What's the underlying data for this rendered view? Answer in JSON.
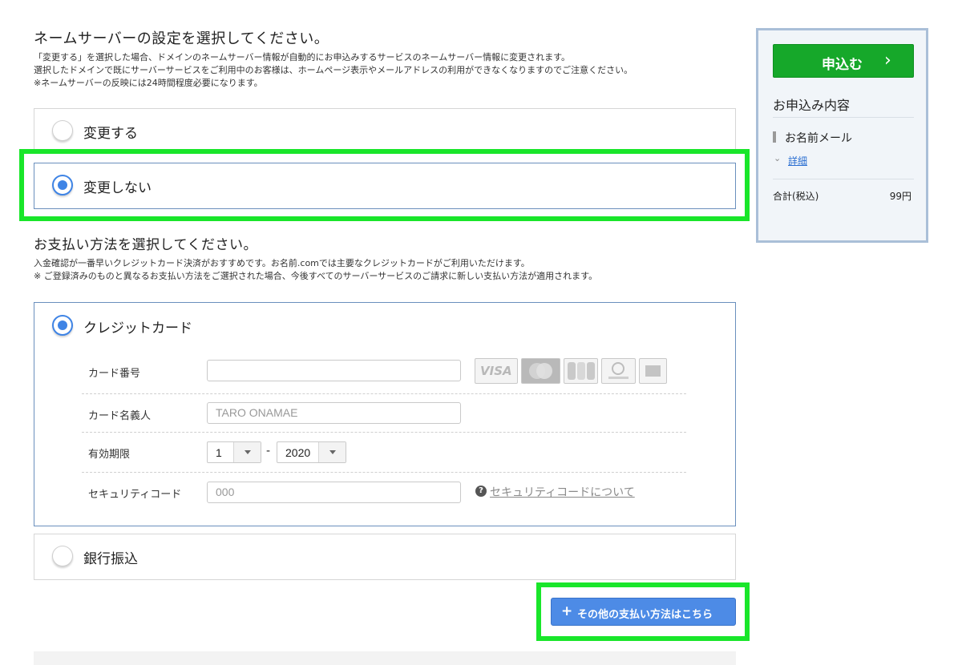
{
  "nameserver": {
    "heading": "ネームサーバーの設定を選択してください。",
    "notes": [
      "「変更する」を選択した場合、ドメインのネームサーバー情報が自動的にお申込みするサービスのネームサーバー情報に変更されます。",
      "選択したドメインで既にサーバーサービスをご利用中のお客様は、ホームページ表示やメールアドレスの利用ができなくなりますのでご注意ください。",
      "※ネームサーバーの反映には24時間程度必要になります。"
    ],
    "options": [
      {
        "label": "変更する",
        "selected": false
      },
      {
        "label": "変更しない",
        "selected": true
      }
    ]
  },
  "payment": {
    "heading": "お支払い方法を選択してください。",
    "notes": [
      "入金確認が一番早いクレジットカード決済がおすすめです。お名前.comでは主要なクレジットカードがご利用いただけます。",
      "※ ご登録済みのものと異なるお支払い方法をご選択された場合、今後すべてのサーバーサービスのご請求に新しい支払い方法が適用されます。"
    ],
    "credit_card": {
      "label": "クレジットカード",
      "selected": true,
      "fields": {
        "card_number_label": "カード番号",
        "card_number_value": "",
        "card_holder_label": "カード名義人",
        "card_holder_placeholder": "TARO ONAMAE",
        "expiry_label": "有効期限",
        "expiry_month": "1",
        "expiry_separator": "-",
        "expiry_year": "2020",
        "security_label": "セキュリティコード",
        "security_placeholder": "000",
        "security_help_link": "セキュリティコードについて",
        "help_icon_glyph": "?"
      },
      "card_logos": [
        "visa-logo",
        "mastercard-logo",
        "jcb-logo",
        "diners-club-logo",
        "amex-logo"
      ],
      "card_logo_visa_text": "VISA"
    },
    "bank_transfer": {
      "label": "銀行振込",
      "selected": false
    },
    "other_methods_button": "その他の支払い方法はこちら",
    "other_methods_icon": "+"
  },
  "sidebar": {
    "apply_button": "申込む",
    "apply_chevron": "›",
    "summary_title": "お申込み内容",
    "item_name": "お名前メール",
    "details_chevron": "⌄",
    "details_link": "詳細",
    "total_label": "合計(税込)",
    "total_value": "99円"
  },
  "colors": {
    "highlight": "#19e62a",
    "primary_button": "#16a82a",
    "radio_selected": "#3f84e5",
    "secondary_button": "#4d8be6"
  }
}
